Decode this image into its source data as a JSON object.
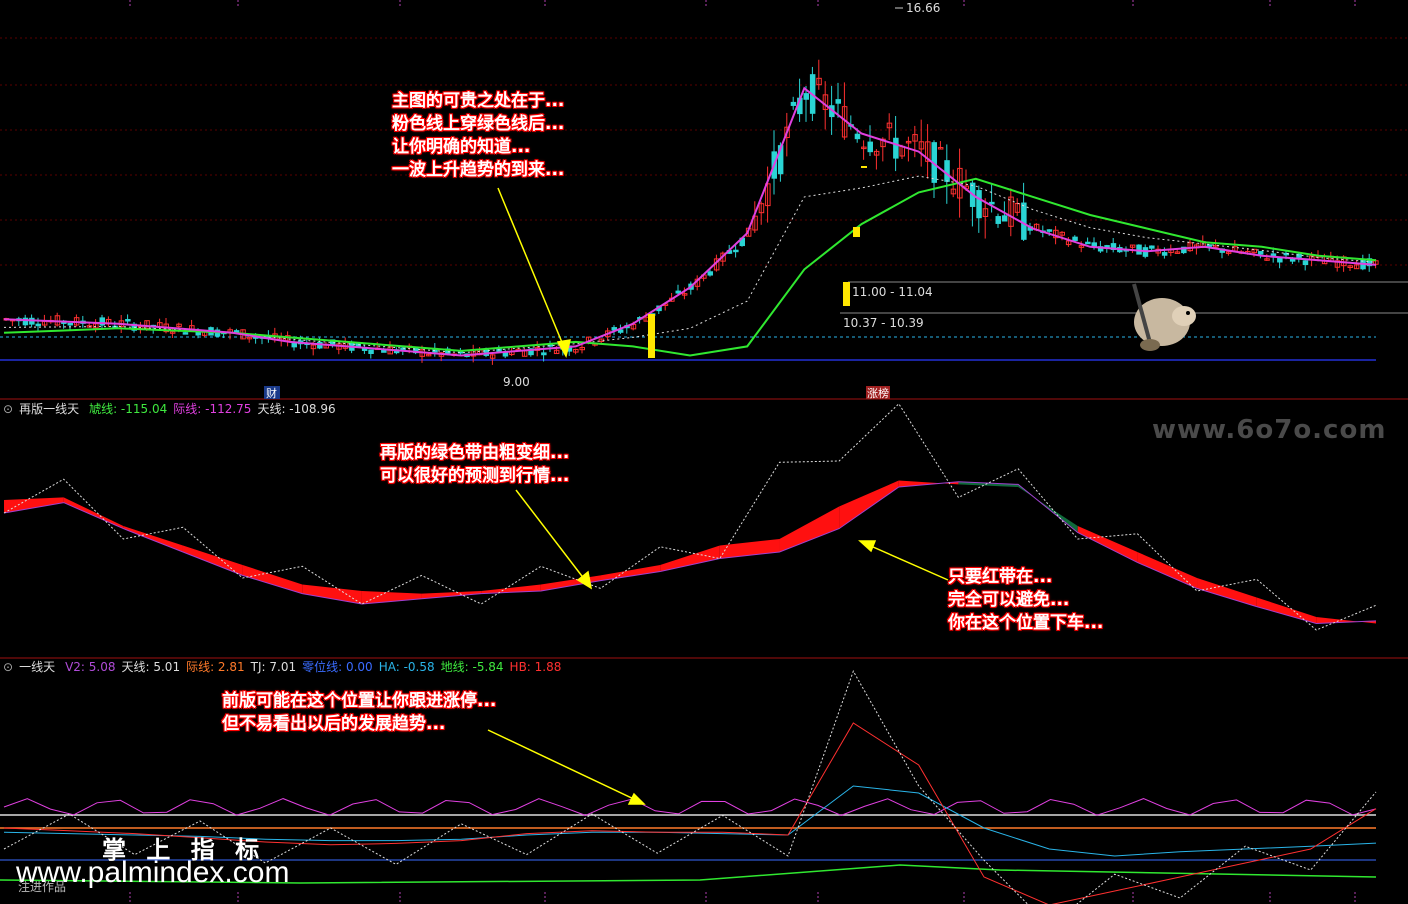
{
  "panels": {
    "main": {
      "price_max_label": "16.66",
      "price_low_label": "9.00",
      "zone_upper_label": "11.00 - 11.04",
      "zone_lower_label": "10.37 - 10.39",
      "marker_left": "财",
      "marker_right": "涨榜"
    },
    "p2": {
      "title": "再版一线天",
      "items": [
        {
          "label": "虓线:",
          "value": "-115.04",
          "color": "#3fe83f"
        },
        {
          "label": "际线:",
          "value": "-112.75",
          "color": "#e040e0"
        },
        {
          "label": "天线:",
          "value": "-108.96",
          "color": "#dddddd"
        }
      ]
    },
    "p3": {
      "title": "一线天",
      "items": [
        {
          "label": "V2:",
          "value": "5.08",
          "color": "#b04cd8"
        },
        {
          "label": "天线:",
          "value": "5.01",
          "color": "#dddddd"
        },
        {
          "label": "际线:",
          "value": "2.81",
          "color": "#ff7a2a"
        },
        {
          "label": "TJ:",
          "value": "7.01",
          "color": "#dddddd"
        },
        {
          "label": "零位线:",
          "value": "0.00",
          "color": "#3a6cff"
        },
        {
          "label": "HA:",
          "value": "-0.58",
          "color": "#2ab4e8"
        },
        {
          "label": "地线:",
          "value": "-5.84",
          "color": "#3fe83f"
        },
        {
          "label": "HB:",
          "value": "1.88",
          "color": "#ff3030"
        }
      ]
    }
  },
  "callouts": {
    "c1": [
      "主图的可贵之处在于...",
      "粉色线上穿绿色线后...",
      "让你明确的知道...",
      "一波上升趋势的到来..."
    ],
    "c2": [
      "再版的绿色带由粗变细...",
      "可以很好的预测到行情..."
    ],
    "c3": [
      "只要红带在...",
      "完全可以避免...",
      "你在这个位置下车..."
    ],
    "c4": [
      "前版可能在这个位置让你跟进涨停...",
      "但不易看出以后的发展趋势..."
    ]
  },
  "watermarks": {
    "site1": "www.6o7o.com",
    "cn": "掌 上 指 标",
    "site2": "www.palmindex.com",
    "corner": "注进作品"
  },
  "chart_data": {
    "type": "line",
    "main_series": [
      {
        "name": "Pink",
        "values": [
          9.9,
          9.85,
          9.8,
          9.7,
          9.6,
          9.4,
          9.3,
          9.2,
          9.1,
          9.2,
          9.3,
          9.8,
          10.6,
          11.8,
          15.0,
          14.0,
          13.6,
          12.6,
          11.9,
          11.5,
          11.4,
          11.5,
          11.3,
          11.2,
          11.1
        ]
      },
      {
        "name": "Green",
        "values": [
          9.6,
          9.65,
          9.7,
          9.65,
          9.6,
          9.5,
          9.4,
          9.3,
          9.2,
          9.3,
          9.4,
          9.3,
          9.1,
          9.3,
          11.0,
          12.0,
          12.7,
          13.0,
          12.6,
          12.2,
          11.9,
          11.6,
          11.5,
          11.3,
          11.2
        ]
      }
    ],
    "p2_series": [
      {
        "name": "虓线",
        "values": [
          -20,
          -18,
          -40,
          -55,
          -70,
          -85,
          -90,
          -92,
          -90,
          -85,
          -78,
          -70,
          -55,
          -50,
          -25,
          -5,
          -8,
          -10,
          -40,
          -60,
          -80,
          -95,
          -110,
          -115
        ]
      },
      {
        "name": "际线",
        "values": [
          -30,
          -22,
          -42,
          -60,
          -78,
          -92,
          -100,
          -96,
          -92,
          -90,
          -82,
          -75,
          -65,
          -60,
          -42,
          -10,
          -6,
          -8,
          -45,
          -68,
          -88,
          -102,
          -115,
          -113
        ]
      }
    ],
    "p3_series": [
      {
        "name": "HB",
        "values": [
          0.5,
          0.3,
          0.1,
          -0.2,
          -0.5,
          -0.7,
          -0.6,
          -0.4,
          0.1,
          0.3,
          0.2,
          0.2,
          0.0,
          8.0,
          5.0,
          -3.0,
          -5.0,
          -4.0,
          -3.0,
          -2.0,
          -1.0,
          1.88
        ]
      },
      {
        "name": "HA",
        "values": [
          0.2,
          0.1,
          0.0,
          -0.1,
          -0.3,
          -0.4,
          -0.4,
          -0.3,
          0.0,
          0.2,
          0.2,
          0.1,
          0.0,
          3.5,
          3.0,
          0.5,
          -1.0,
          -1.5,
          -1.2,
          -1.0,
          -0.8,
          -0.58
        ]
      }
    ]
  }
}
